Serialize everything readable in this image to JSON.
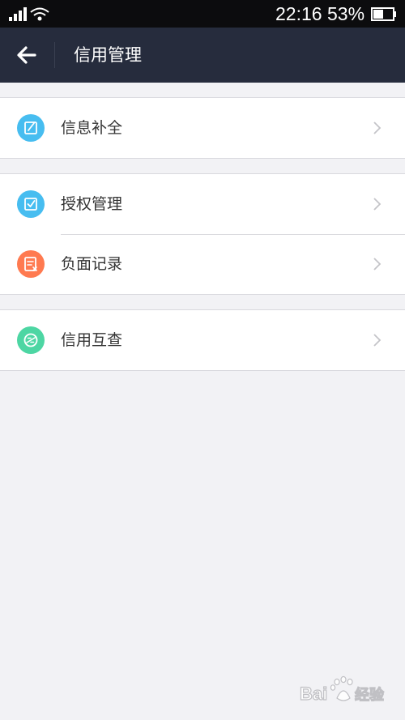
{
  "status_bar": {
    "time": "22:16",
    "battery_percent": "53%",
    "battery_level": 0.53,
    "signal_icon": "signal-bars-icon",
    "wifi_icon": "wifi-icon",
    "battery_icon": "battery-icon"
  },
  "header": {
    "title": "信用管理",
    "back_icon": "arrow-left-icon",
    "background": "#262c3d"
  },
  "groups": [
    {
      "items": [
        {
          "label": "信息补全",
          "icon": "edit-icon",
          "icon_color": "#47bdf0"
        }
      ]
    },
    {
      "items": [
        {
          "label": "授权管理",
          "icon": "authorize-check-icon",
          "icon_color": "#47bdf0"
        },
        {
          "label": "负面记录",
          "icon": "negative-record-icon",
          "icon_color": "#ff7a50"
        }
      ]
    },
    {
      "items": [
        {
          "label": "信用互查",
          "icon": "mutual-check-icon",
          "icon_color": "#4dd6a3"
        }
      ]
    }
  ],
  "colors": {
    "page_background": "#f2f2f5",
    "chevron": "#c4c4c8",
    "divider": "#d9d9de"
  },
  "watermark": {
    "logo": "baidu-jingyan-watermark"
  }
}
